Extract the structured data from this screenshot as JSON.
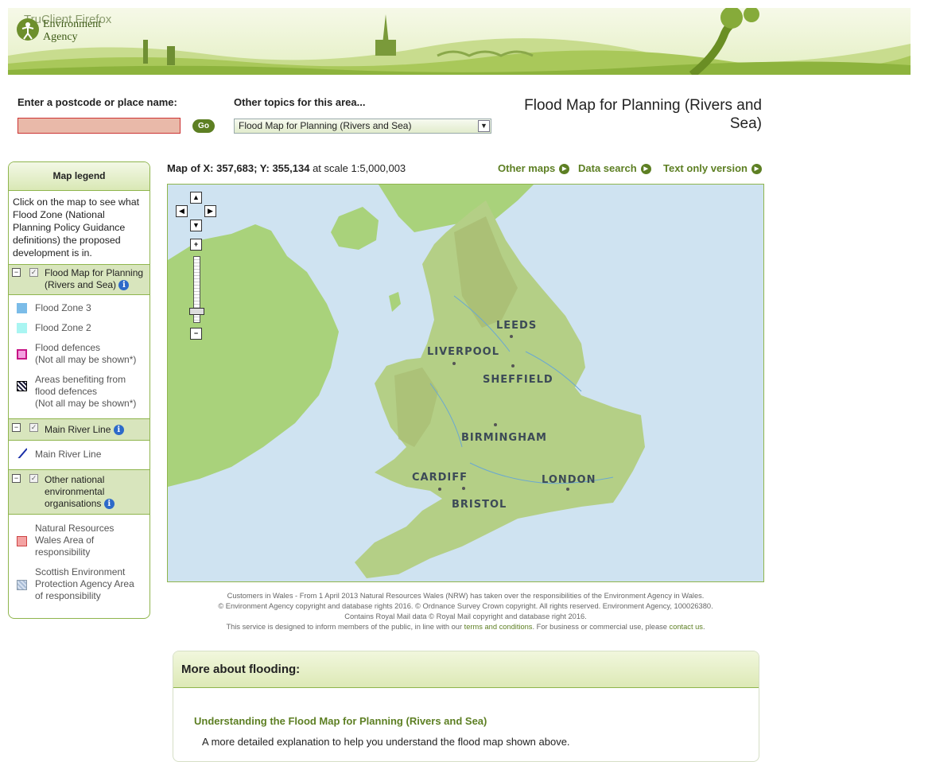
{
  "window": {
    "title": "TruClient Firefox"
  },
  "brand": {
    "name_line1": "Environment",
    "name_line2": "Agency"
  },
  "search": {
    "label": "Enter a postcode or place name:",
    "value": "",
    "go_label": "Go"
  },
  "topics": {
    "label": "Other topics for this area...",
    "selected": "Flood Map for Planning (Rivers and Sea)"
  },
  "page": {
    "title": "Flood Map for Planning (Rivers and Sea)"
  },
  "legend": {
    "title": "Map legend",
    "intro": "Click on the map to see what Flood Zone (National Planning Policy Guidance definitions) the proposed development is in.",
    "layers": [
      {
        "name": "Flood Map for Planning (Rivers and Sea)",
        "items": [
          {
            "label": "Flood Zone 3",
            "color": "#7bbce8"
          },
          {
            "label": "Flood Zone 2",
            "color": "#a9f5f2"
          },
          {
            "label": "Flood defences",
            "note": "(Not all may be shown*)",
            "color": "#c71585"
          },
          {
            "label": "Areas benefiting from flood defences",
            "note": "(Not all may be shown*)",
            "color": "#1b1b3a"
          }
        ]
      },
      {
        "name": "Main River Line",
        "items": [
          {
            "label": "Main River Line",
            "color": "#1a2fa8"
          }
        ]
      },
      {
        "name": "Other national environmental organisations",
        "items": [
          {
            "label": "Natural Resources Wales Area of responsibility",
            "color": "#f4a3a3"
          },
          {
            "label": "Scottish Environment Protection Agency Area of responsibility",
            "color": "#a9bcd6"
          }
        ]
      }
    ]
  },
  "map": {
    "header_prefix": "Map of X: 357,683; Y: 355,134",
    "header_suffix": "at scale 1:5,000,003",
    "cities": [
      "LEEDS",
      "LIVERPOOL",
      "SHEFFIELD",
      "BIRMINGHAM",
      "CARDIFF",
      "LONDON",
      "BRISTOL"
    ],
    "nav": {
      "up": "▲",
      "left": "◀",
      "right": "▶",
      "down": "▼",
      "zoom_in": "+",
      "zoom_out": "−"
    }
  },
  "links": {
    "other_maps": "Other maps",
    "data_search": "Data search",
    "text_only": "Text only version"
  },
  "footer": {
    "line1": "Customers in Wales - From 1 April 2013 Natural Resources Wales (NRW) has taken over the responsibilities of the Environment Agency in Wales.",
    "line2": "© Environment Agency copyright and database rights 2016. © Ordnance Survey Crown copyright. All rights reserved. Environment Agency, 100026380.",
    "line3": "Contains Royal Mail data © Royal Mail copyright and database right 2016.",
    "line4_pre": "This service is designed to inform members of the public, in line with our",
    "terms": "terms and conditions",
    "line4_mid": ". For business or commercial use, please",
    "contact": "contact us",
    "line4_end": "."
  },
  "more": {
    "title": "More about flooding:",
    "link": "Understanding the Flood Map for Planning (Rivers and Sea)",
    "desc": "A more detailed explanation to help you understand the flood map shown above."
  }
}
